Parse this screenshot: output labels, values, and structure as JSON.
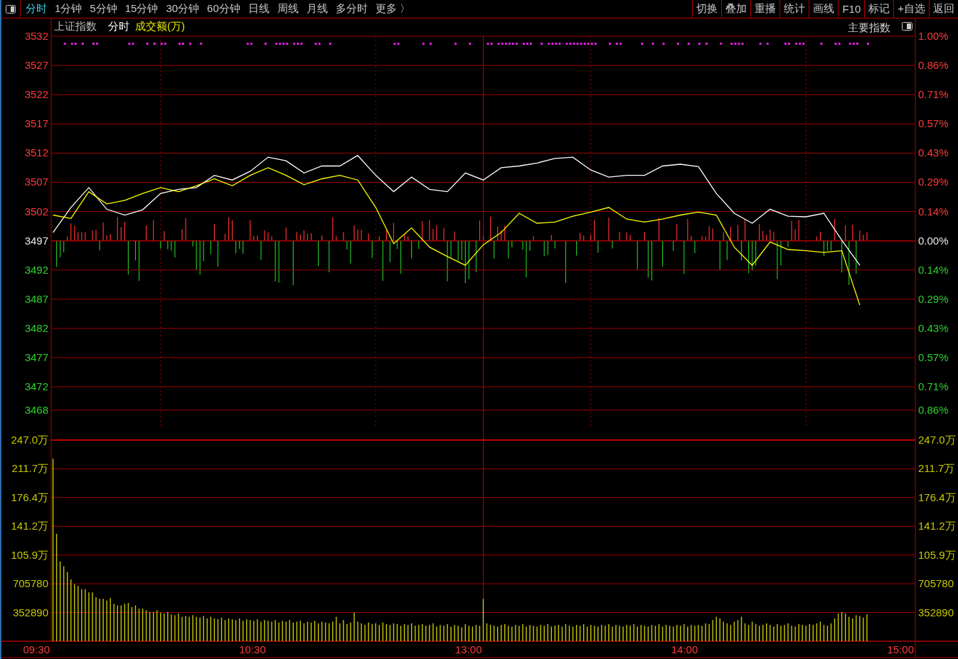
{
  "toolbar": {
    "tabs": [
      {
        "label": "分时",
        "selected": true
      },
      {
        "label": "1分钟",
        "selected": false
      },
      {
        "label": "5分钟",
        "selected": false
      },
      {
        "label": "15分钟",
        "selected": false
      },
      {
        "label": "30分钟",
        "selected": false
      },
      {
        "label": "60分钟",
        "selected": false
      },
      {
        "label": "日线",
        "selected": false
      },
      {
        "label": "周线",
        "selected": false
      },
      {
        "label": "月线",
        "selected": false
      },
      {
        "label": "多分时",
        "selected": false
      },
      {
        "label": "更多 〉",
        "selected": false
      }
    ],
    "buttons": [
      "切换",
      "叠加",
      "重播",
      "统计",
      "画线",
      "F10",
      "标记",
      "+自选",
      "返回"
    ]
  },
  "price_panel": {
    "legend": {
      "index_name": "上证指数",
      "mode": "分时",
      "volume_label": "成交额(万)"
    },
    "selector": "主要指数",
    "right_ticks": [
      "1.00%",
      "0.86%",
      "0.71%",
      "0.57%",
      "0.43%",
      "0.29%",
      "0.14%",
      "0.00%",
      "0.14%",
      "0.29%",
      "0.43%",
      "0.57%",
      "0.71%",
      "0.86%"
    ],
    "chart_data": {
      "type": "line",
      "ylim": [
        3468,
        3532
      ],
      "grid": true,
      "yticks": [
        {
          "value": 3532,
          "label": "3532"
        },
        {
          "value": 3527,
          "label": "3527"
        },
        {
          "value": 3522,
          "label": "3522"
        },
        {
          "value": 3517,
          "label": "3517"
        },
        {
          "value": 3512,
          "label": "3512"
        },
        {
          "value": 3507,
          "label": "3507"
        },
        {
          "value": 3502,
          "label": "3502"
        },
        {
          "value": 3497,
          "label": "3497"
        },
        {
          "value": 3492,
          "label": "3492"
        },
        {
          "value": 3487,
          "label": "3487"
        },
        {
          "value": 3482,
          "label": "3482"
        },
        {
          "value": 3477,
          "label": "3477"
        },
        {
          "value": 3472,
          "label": "3472"
        },
        {
          "value": 3468,
          "label": "3468"
        }
      ],
      "series": [
        {
          "color": "#ffffff",
          "values": [
            3498.4,
            3502.7,
            3506.1,
            3502.4,
            3501.4,
            3502.3,
            3505.1,
            3505.8,
            3506.1,
            3508.2,
            3507.4,
            3508.9,
            3511.3,
            3510.7,
            3508.6,
            3509.8,
            3509.8,
            3511.6,
            3508.2,
            3505.4,
            3507.9,
            3505.8,
            3505.4,
            3508.6,
            3507.4,
            3509.5,
            3509.8,
            3510.3,
            3511.1,
            3511.3,
            3509.1,
            3507.9,
            3508.2,
            3508.2,
            3509.8,
            3510.1,
            3509.7,
            3505.1,
            3501.7,
            3500.0,
            3502.4,
            3501.2,
            3501.1,
            3501.7,
            3497.1,
            3492.8,
            null,
            null,
            null
          ]
        },
        {
          "color": "#ffff00",
          "values": [
            3501.4,
            3500.8,
            3505.4,
            3503.3,
            3503.9,
            3505.1,
            3506.1,
            3505.4,
            3506.4,
            3507.6,
            3506.4,
            3508.2,
            3509.5,
            3508.2,
            3506.6,
            3507.6,
            3508.2,
            3507.4,
            3502.7,
            3496.5,
            3499.2,
            3495.9,
            3494.3,
            3492.8,
            3496.3,
            3498.4,
            3501.7,
            3500.0,
            3500.2,
            3501.2,
            3501.9,
            3502.7,
            3500.7,
            3500.2,
            3500.7,
            3501.4,
            3501.9,
            3501.4,
            3495.9,
            3492.8,
            3496.8,
            3495.5,
            3495.3,
            3495.0,
            3495.3,
            3486.0,
            null,
            null,
            null
          ]
        }
      ]
    }
  },
  "volume_panel": {
    "right_ticks": [
      "247.0万",
      "211.7万",
      "176.4万",
      "141.2万",
      "105.9万",
      "705780",
      "352890"
    ],
    "time_labels": [
      "09:30",
      "10:30",
      "13:00",
      "14:00",
      "15:00"
    ],
    "wan_labels": [
      "247.0万",
      "211.7万",
      "176.4万",
      "141.2万",
      "105.9万"
    ],
    "chart_data": {
      "type": "bar",
      "ylim": [
        0,
        2470230
      ],
      "grid": true,
      "yticks": [
        {
          "value": 705780,
          "label": "705780"
        },
        {
          "value": 352890,
          "label": "352890"
        }
      ],
      "series": [
        {
          "color": "#c8c800",
          "values": [
            2240000,
            1320000,
            980000,
            920000,
            850000,
            760000,
            700000,
            680000,
            640000,
            640000,
            600000,
            600000,
            540000,
            520000,
            520000,
            500000,
            530000,
            460000,
            440000,
            440000,
            460000,
            470000,
            420000,
            440000,
            400000,
            400000,
            380000,
            360000,
            360000,
            380000,
            350000,
            340000,
            360000,
            330000,
            320000,
            340000,
            300000,
            310000,
            300000,
            320000,
            300000,
            290000,
            310000,
            280000,
            300000,
            280000,
            270000,
            290000,
            260000,
            280000,
            270000,
            260000,
            280000,
            250000,
            270000,
            260000,
            250000,
            270000,
            240000,
            260000,
            250000,
            240000,
            260000,
            230000,
            250000,
            240000,
            260000,
            230000,
            240000,
            250000,
            220000,
            240000,
            230000,
            250000,
            220000,
            240000,
            230000,
            220000,
            240000,
            300000,
            220000,
            260000,
            210000,
            230000,
            350000,
            240000,
            220000,
            200000,
            230000,
            210000,
            220000,
            200000,
            230000,
            210000,
            200000,
            220000,
            210000,
            190000,
            210000,
            200000,
            220000,
            190000,
            200000,
            210000,
            190000,
            200000,
            220000,
            180000,
            200000,
            190000,
            210000,
            180000,
            200000,
            190000,
            170000,
            210000,
            190000,
            180000,
            200000,
            190000,
            520000,
            220000,
            200000,
            190000,
            180000,
            200000,
            210000,
            190000,
            180000,
            200000,
            190000,
            210000,
            180000,
            200000,
            190000,
            180000,
            200000,
            190000,
            210000,
            180000,
            190000,
            200000,
            180000,
            210000,
            190000,
            180000,
            200000,
            190000,
            210000,
            180000,
            200000,
            190000,
            180000,
            200000,
            190000,
            210000,
            180000,
            200000,
            190000,
            180000,
            200000,
            190000,
            210000,
            180000,
            200000,
            190000,
            180000,
            200000,
            190000,
            210000,
            180000,
            200000,
            190000,
            180000,
            200000,
            190000,
            210000,
            180000,
            200000,
            190000,
            200000,
            190000,
            220000,
            210000,
            260000,
            300000,
            280000,
            240000,
            220000,
            200000,
            240000,
            260000,
            300000,
            220000,
            200000,
            240000,
            210000,
            190000,
            200000,
            220000,
            200000,
            180000,
            210000,
            190000,
            200000,
            220000,
            190000,
            180000,
            210000,
            200000,
            190000,
            210000,
            200000,
            220000,
            240000,
            200000,
            190000,
            220000,
            280000,
            340000,
            360000,
            340000,
            300000,
            280000,
            320000,
            310000,
            290000,
            330000,
            null,
            null,
            null,
            null,
            null,
            null,
            null,
            null,
            null,
            null,
            null,
            null,
            null
          ]
        }
      ]
    }
  }
}
